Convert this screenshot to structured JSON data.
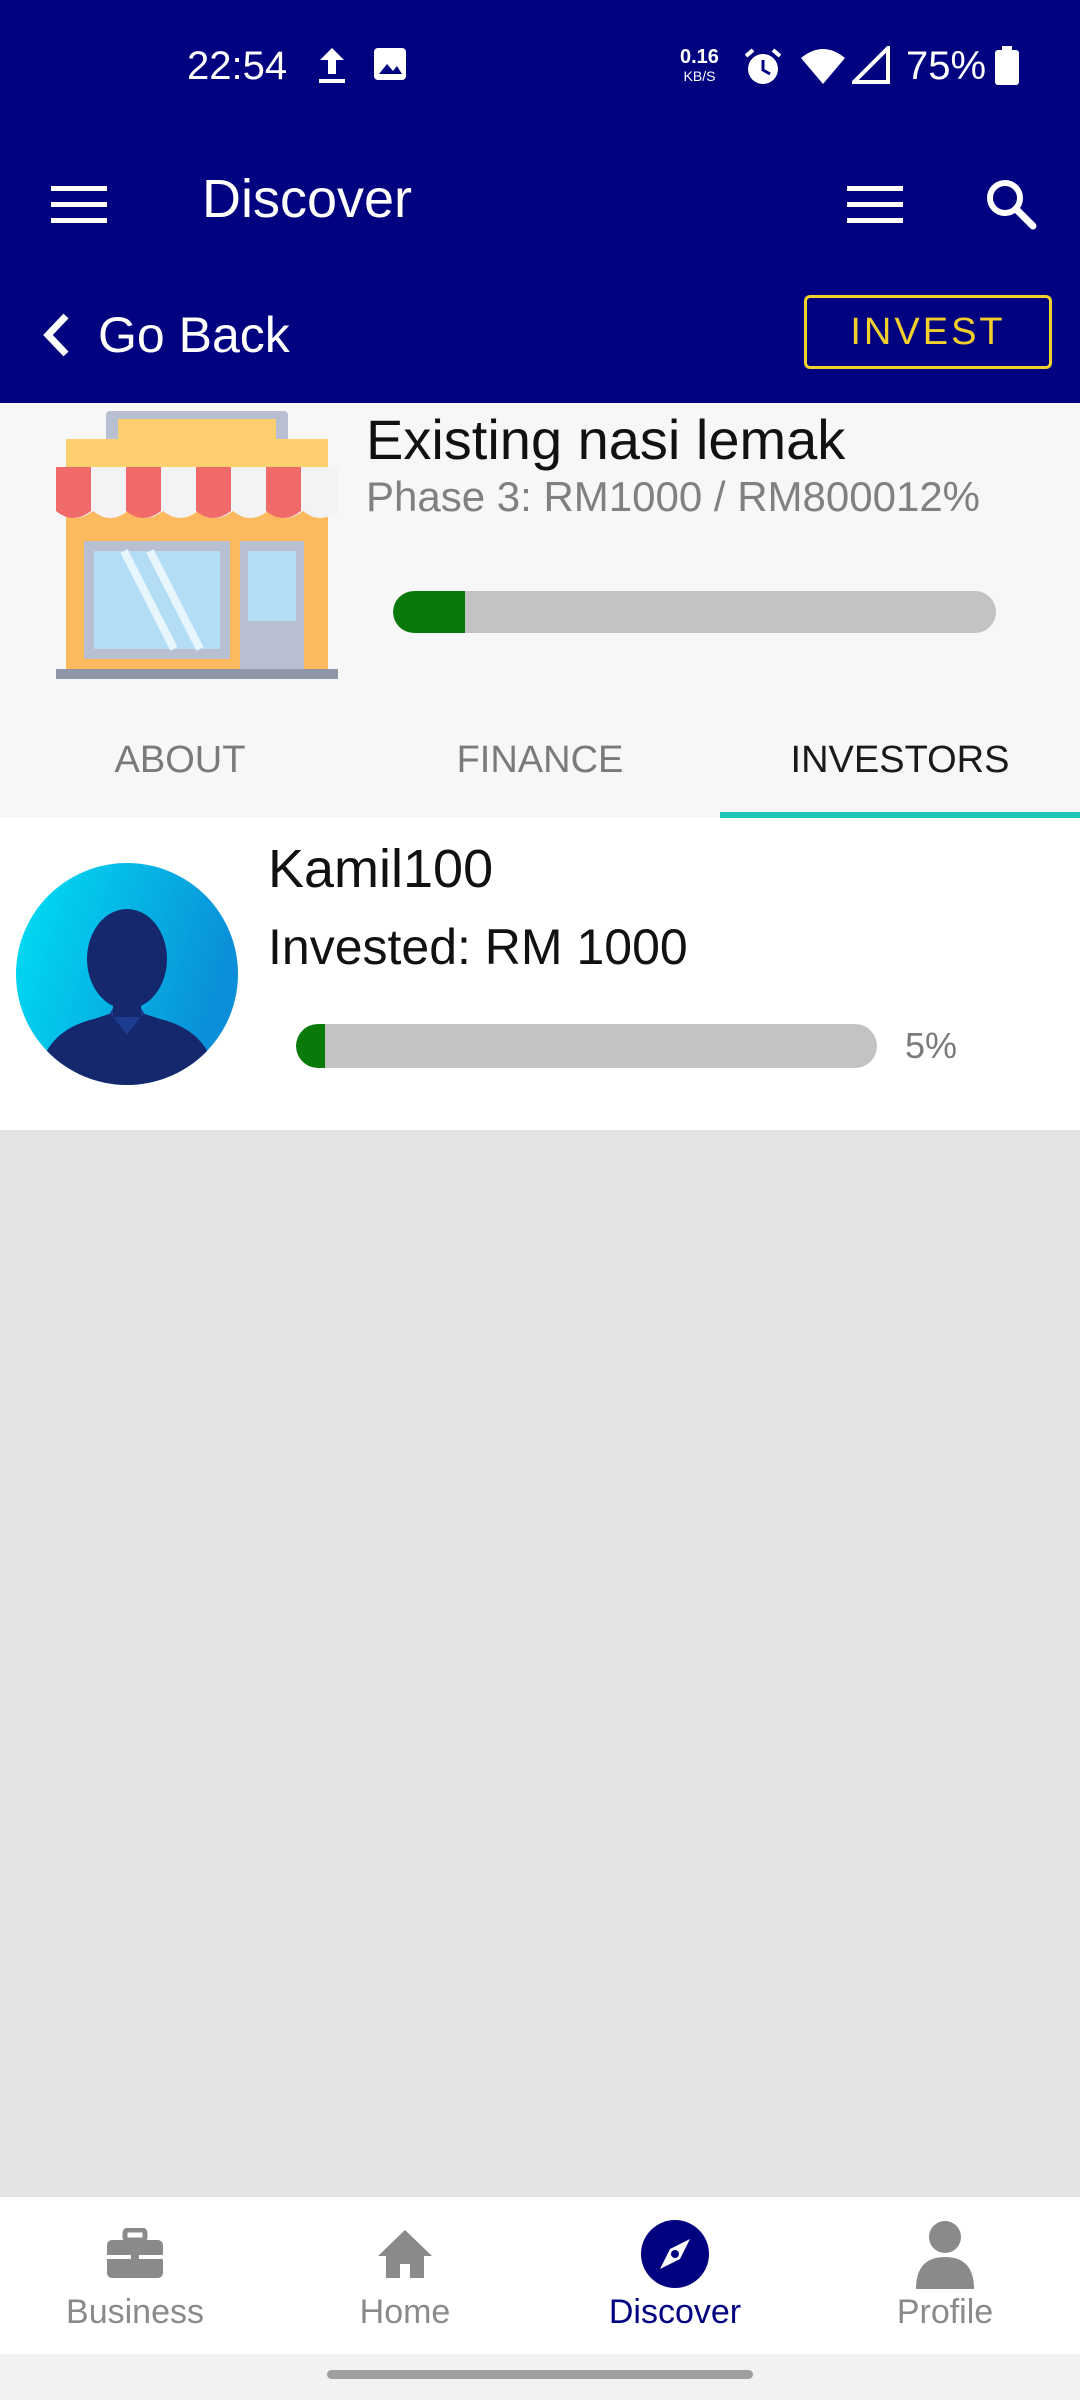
{
  "status_bar": {
    "time": "22:54",
    "net_speed_value": "0.16",
    "net_speed_unit": "KB/S",
    "battery": "75%"
  },
  "app_bar": {
    "title": "Discover"
  },
  "sub_bar": {
    "back_label": "Go Back",
    "invest_label": "INVEST"
  },
  "business": {
    "name": "Existing nasi lemak",
    "phase_text": "Phase 3: RM1000 / RM800012%",
    "progress_fraction": 0.12
  },
  "tabs": [
    {
      "label": "ABOUT",
      "active": false
    },
    {
      "label": "FINANCE",
      "active": false
    },
    {
      "label": "INVESTORS",
      "active": true
    }
  ],
  "investors": [
    {
      "name": "Kamil100",
      "invested": "Invested: RM 1000",
      "percent_label": "5%",
      "progress_fraction": 0.05
    }
  ],
  "bottom_nav": [
    {
      "label": "Business",
      "icon": "briefcase-icon",
      "active": false
    },
    {
      "label": "Home",
      "icon": "home-icon",
      "active": false
    },
    {
      "label": "Discover",
      "icon": "compass-icon",
      "active": true
    },
    {
      "label": "Profile",
      "icon": "person-icon",
      "active": false
    }
  ],
  "colors": {
    "primary": "#01027f",
    "accent_yellow": "#f3cf2c",
    "tab_indicator": "#1fc6b5",
    "progress_fill": "#097a09",
    "progress_track": "#c3c3c3"
  }
}
